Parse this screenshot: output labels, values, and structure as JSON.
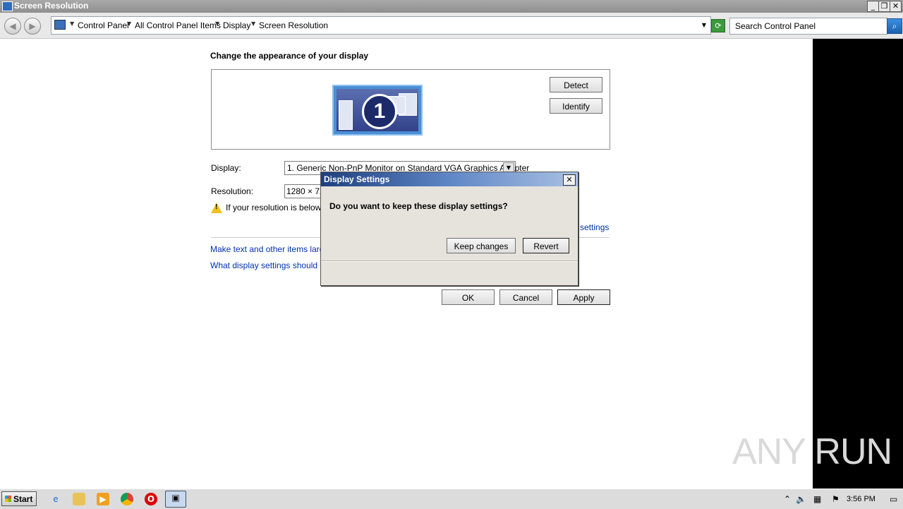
{
  "window": {
    "title": "Screen Resolution",
    "min": "_",
    "max": "❐",
    "close": "✕"
  },
  "nav": {
    "back": "◀",
    "forward": "▶",
    "breadcrumbs": [
      "Control Panel",
      "All Control Panel Items",
      "Display",
      "Screen Resolution"
    ],
    "search_placeholder": "Search Control Panel"
  },
  "main": {
    "heading": "Change the appearance of your display",
    "monitor_number": "1",
    "detect_label": "Detect",
    "identify_label": "Identify",
    "display_label": "Display:",
    "display_value": "1. Generic Non-PnP Monitor on Standard VGA Graphics Adapter",
    "resolution_label": "Resolution:",
    "resolution_value": "1280 × 720",
    "warning_text": "If your resolution is below 1",
    "advanced_link": "d settings",
    "link_text_size": "Make text and other items larger",
    "link_which_settings": "What display settings should I ch",
    "ok_label": "OK",
    "cancel_label": "Cancel",
    "apply_label": "Apply"
  },
  "dialog": {
    "title": "Display Settings",
    "question": "Do you want to keep these display settings?",
    "keep_label": "Keep changes",
    "revert_label": "Revert"
  },
  "taskbar": {
    "start_label": "Start",
    "clock": "3:56 PM",
    "pinned": [
      "ie-icon",
      "explorer-icon",
      "media-player-icon",
      "chrome-icon",
      "opera-icon",
      "display-settings-icon"
    ]
  },
  "watermark": "ANY RUN"
}
